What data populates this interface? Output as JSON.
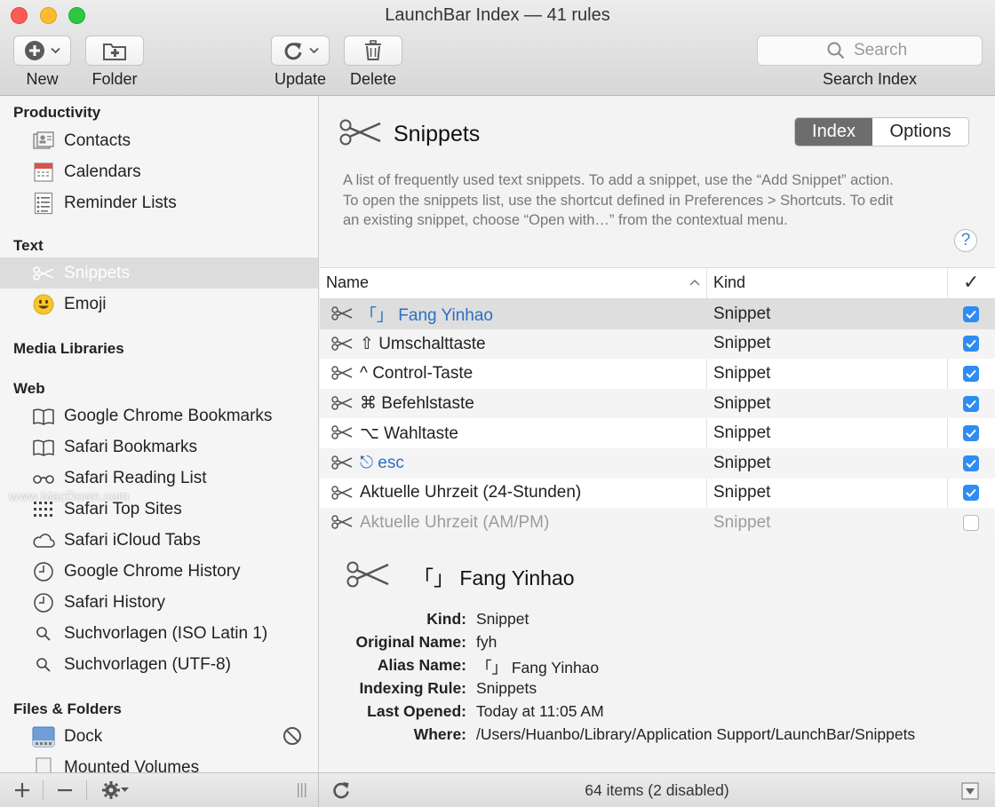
{
  "window": {
    "title": "LaunchBar Index — 41 rules"
  },
  "toolbar": {
    "new_label": "New",
    "folder_label": "Folder",
    "update_label": "Update",
    "delete_label": "Delete",
    "search_placeholder": "Search",
    "search_label": "Search Index"
  },
  "sidebar": {
    "sections": {
      "productivity": "Productivity",
      "text": "Text",
      "media": "Media Libraries",
      "web": "Web",
      "files": "Files & Folders"
    },
    "items": {
      "contacts": "Contacts",
      "calendars": "Calendars",
      "reminders": "Reminder Lists",
      "snippets": "Snippets",
      "emoji": "Emoji",
      "chrome_bookmarks": "Google Chrome Bookmarks",
      "safari_bookmarks": "Safari Bookmarks",
      "safari_reading": "Safari Reading List",
      "safari_top": "Safari Top Sites",
      "safari_icloud": "Safari iCloud Tabs",
      "chrome_history": "Google Chrome History",
      "safari_history": "Safari History",
      "such_latin": "Suchvorlagen (ISO Latin 1)",
      "such_utf8": "Suchvorlagen (UTF-8)",
      "dock": "Dock",
      "mounted": "Mounted Volumes"
    },
    "watermark": "www.MacDown.com"
  },
  "main": {
    "title": "Snippets",
    "tabs": {
      "index": "Index",
      "options": "Options"
    },
    "description": "A list of frequently used text snippets. To add a snippet, use the “Add Snippet” action. To open the snippets list, use the shortcut defined in Preferences > Shortcuts. To edit an existing snippet, choose “Open with…” from the contextual menu.",
    "help": "?",
    "columns": {
      "name": "Name",
      "kind": "Kind",
      "check": "✓"
    },
    "rows": [
      {
        "name": "「」 Fang Yinhao",
        "kind": "Snippet",
        "checked": true
      },
      {
        "name": "⇧ Umschalttaste",
        "kind": "Snippet",
        "checked": true
      },
      {
        "name": "^ Control-Taste",
        "kind": "Snippet",
        "checked": true
      },
      {
        "name": "⌘ Befehlstaste",
        "kind": "Snippet",
        "checked": true
      },
      {
        "name": "⌥ Wahltaste",
        "kind": "Snippet",
        "checked": true
      },
      {
        "name": "⎋ esc",
        "kind": "Snippet",
        "checked": true
      },
      {
        "name": "Aktuelle Uhrzeit (24-Stunden)",
        "kind": "Snippet",
        "checked": true
      },
      {
        "name": "Aktuelle Uhrzeit (AM/PM)",
        "kind": "Snippet",
        "checked": false
      }
    ],
    "detail": {
      "title": "「」 Fang Yinhao",
      "kind_label": "Kind:",
      "kind": "Snippet",
      "original_label": "Original Name:",
      "original": "fyh",
      "alias_label": "Alias Name:",
      "alias": "「」 Fang Yinhao",
      "rule_label": "Indexing Rule:",
      "rule": "Snippets",
      "opened_label": "Last Opened:",
      "opened": "Today at 11:05 AM",
      "where_label": "Where:",
      "where": "/Users/Huanbo/Library/Application Support/LaunchBar/Snippets"
    },
    "status": "64 items (2 disabled)"
  },
  "colors": {
    "accent": "#2f8cf3",
    "selected_tab": "#6d6d6d"
  }
}
